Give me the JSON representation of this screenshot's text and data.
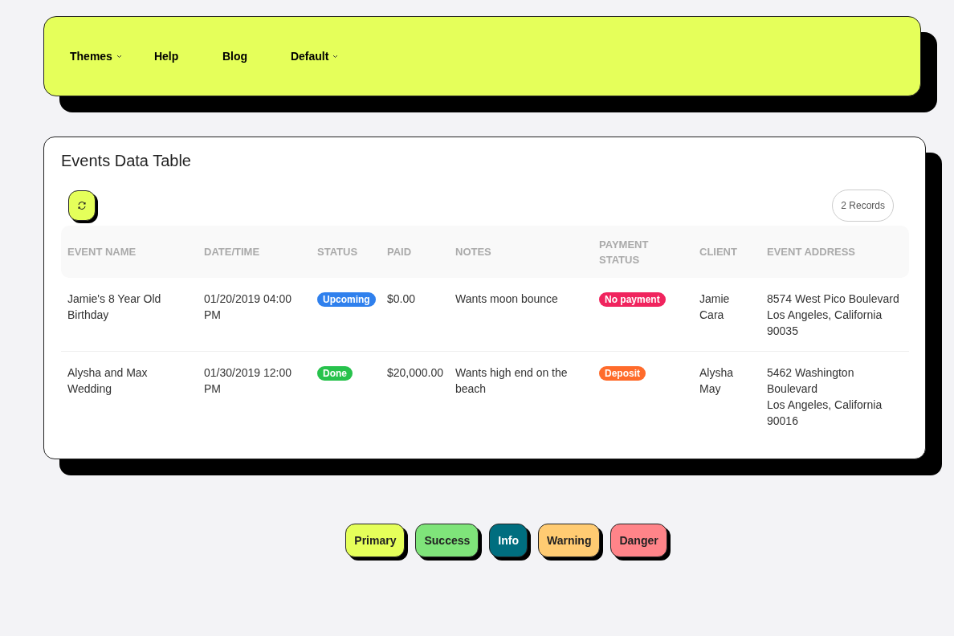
{
  "nav": {
    "items": [
      {
        "label": "Themes",
        "dropdown": true
      },
      {
        "label": "Help",
        "dropdown": false
      },
      {
        "label": "Blog",
        "dropdown": false
      },
      {
        "label": "Default",
        "dropdown": true
      }
    ]
  },
  "table_card": {
    "title": "Events Data Table",
    "record_count": "2 Records",
    "table": {
      "columns": [
        "EVENT NAME",
        "DATE/TIME",
        "STATUS",
        "PAID",
        "NOTES",
        "PAYMENT STATUS",
        "CLIENT",
        "EVENT ADDRESS"
      ],
      "rows": [
        {
          "event_name": "Jamie's 8 Year Old Birthday",
          "date_time": "01/20/2019 04:00 PM",
          "status": {
            "label": "Upcoming",
            "color": "#2f80ed"
          },
          "paid": "$0.00",
          "notes": "Wants moon bounce",
          "payment_status": {
            "label": "No payment",
            "color": "#f0245e"
          },
          "client": "Jamie Cara",
          "address_lines": [
            "8574 West Pico Boulevard",
            "Los Angeles, California",
            "90035"
          ]
        },
        {
          "event_name": "Alysha and Max Wedding",
          "date_time": "01/30/2019 12:00 PM",
          "status": {
            "label": "Done",
            "color": "#27c24c"
          },
          "paid": "$20,000.00",
          "notes": "Wants high end on the beach",
          "payment_status": {
            "label": "Deposit",
            "color": "#ff6b2b"
          },
          "client": "Alysha May",
          "address_lines": [
            "5462 Washington Boulevard",
            "Los Angeles, California",
            "90016"
          ]
        }
      ]
    }
  },
  "theme_buttons": [
    {
      "label": "Primary",
      "color": "#e5ff5a"
    },
    {
      "label": "Success",
      "color": "#7fe47a"
    },
    {
      "label": "Info",
      "color": "#006e7f"
    },
    {
      "label": "Warning",
      "color": "#ffcb72"
    },
    {
      "label": "Danger",
      "color": "#ff8489"
    }
  ]
}
